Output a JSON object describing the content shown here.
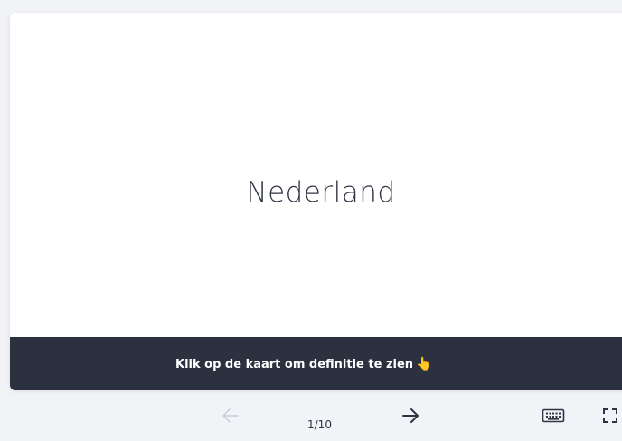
{
  "card": {
    "term": "Nederland",
    "hint": "Klik op de kaart om definitie te zien",
    "hint_emoji": "👆"
  },
  "navigation": {
    "counter": "1/10",
    "prev_icon": "arrow-left-icon",
    "next_icon": "arrow-right-icon",
    "keyboard_icon": "keyboard-icon",
    "fullscreen_icon": "fullscreen-icon"
  },
  "colors": {
    "background": "#f2f3f6",
    "card": "#ffffff",
    "hint_bar": "#2c3140",
    "text_dark": "#2f3443",
    "icon_disabled": "#c8ccd6",
    "emoji": "#f5b72a"
  }
}
